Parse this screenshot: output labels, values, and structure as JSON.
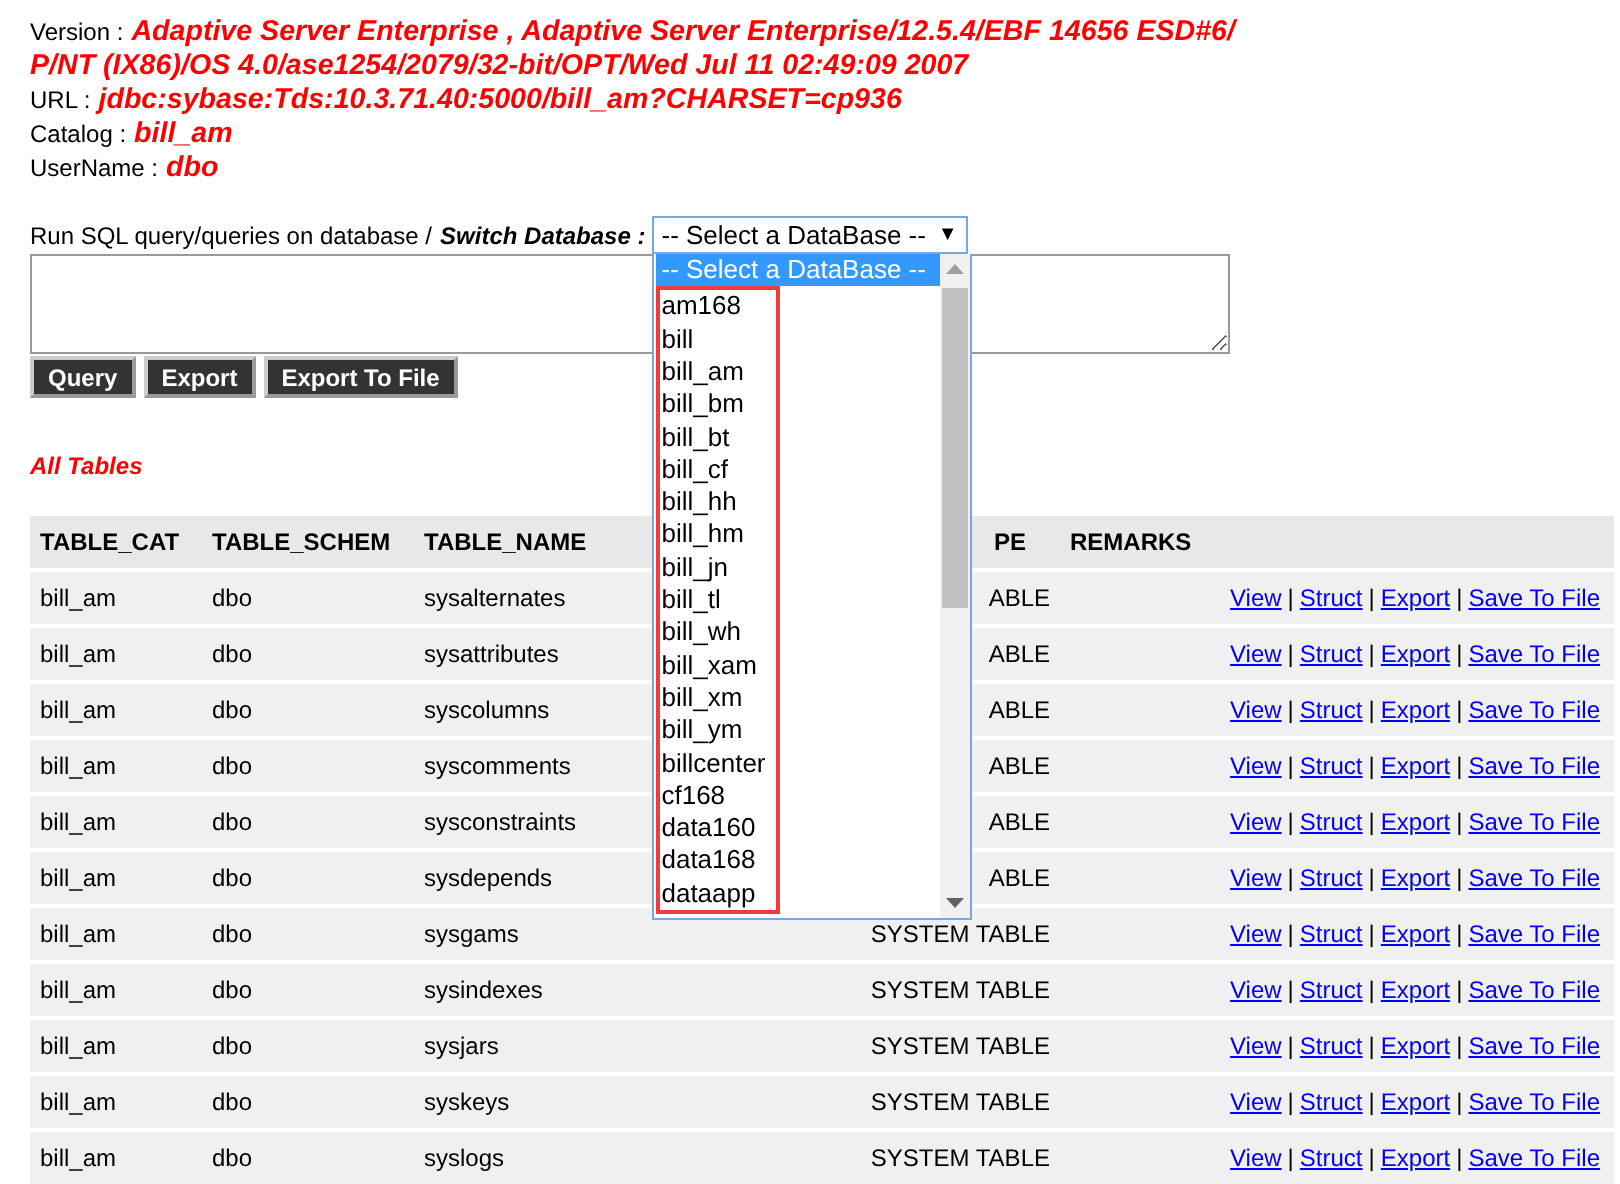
{
  "info": [
    {
      "label": "Version :",
      "value": "Adaptive Server Enterprise , Adaptive Server Enterprise/12.5.4/EBF 14656 ESD#6/",
      "value_line_2": "P/NT (IX86)/OS 4.0/ase1254/2079/32-bit/OPT/Wed Jul 11 02:49:09 2007"
    },
    {
      "label": "URL :",
      "value": "jdbc:sybase:Tds:10.3.71.40:5000/bill_am?CHARSET=cp936"
    },
    {
      "label": "Catalog :",
      "value": "bill_am"
    },
    {
      "label": "UserName :",
      "value": "dbo"
    }
  ],
  "query": {
    "label": "Run SQL query/queries on database /",
    "switch_label": "Switch Database :",
    "select_value": "-- Select a DataBase --",
    "caret": "▼",
    "options": [
      {
        "label": "-- Select a DataBase --",
        "selected": true
      },
      {
        "label": "am168",
        "selected": false
      },
      {
        "label": "bill",
        "selected": false
      },
      {
        "label": "bill_am",
        "selected": false
      },
      {
        "label": "bill_bm",
        "selected": false
      },
      {
        "label": "bill_bt",
        "selected": false
      },
      {
        "label": "bill_cf",
        "selected": false
      },
      {
        "label": "bill_hh",
        "selected": false
      },
      {
        "label": "bill_hm",
        "selected": false
      },
      {
        "label": "bill_jn",
        "selected": false
      },
      {
        "label": "bill_tl",
        "selected": false
      },
      {
        "label": "bill_wh",
        "selected": false
      },
      {
        "label": "bill_xam",
        "selected": false
      },
      {
        "label": "bill_xm",
        "selected": false
      },
      {
        "label": "bill_ym",
        "selected": false
      },
      {
        "label": "billcenter",
        "selected": false
      },
      {
        "label": "cf168",
        "selected": false
      },
      {
        "label": "data160",
        "selected": false
      },
      {
        "label": "data168",
        "selected": false
      },
      {
        "label": "dataapp",
        "selected": false
      }
    ],
    "buttons": [
      "Query",
      "Export",
      "Export To File"
    ]
  },
  "section_title": "All Tables",
  "table": {
    "columns": [
      "TABLE_CAT",
      "TABLE_SCHEM",
      "TABLE_NAME",
      "PE",
      "REMARKS"
    ],
    "rows": [
      {
        "cat": "bill_am",
        "schem": "dbo",
        "name": "sysalternates",
        "type": "ABLE",
        "actions": [
          {
            "kind": "link",
            "text": "View"
          },
          {
            "kind": "sep",
            "text": "|"
          },
          {
            "kind": "link",
            "text": "Struct"
          },
          {
            "kind": "sep",
            "text": "|"
          },
          {
            "kind": "link",
            "text": "Export"
          },
          {
            "kind": "sep",
            "text": "|"
          },
          {
            "kind": "link",
            "text": "Save To File"
          }
        ]
      },
      {
        "cat": "bill_am",
        "schem": "dbo",
        "name": "sysattributes",
        "type": "ABLE",
        "actions": [
          {
            "kind": "link",
            "text": "View"
          },
          {
            "kind": "sep",
            "text": "|"
          },
          {
            "kind": "link",
            "text": "Struct"
          },
          {
            "kind": "sep",
            "text": "|"
          },
          {
            "kind": "link",
            "text": "Export"
          },
          {
            "kind": "sep",
            "text": "|"
          },
          {
            "kind": "link",
            "text": "Save To File"
          }
        ]
      },
      {
        "cat": "bill_am",
        "schem": "dbo",
        "name": "syscolumns",
        "type": "ABLE",
        "actions": [
          {
            "kind": "link",
            "text": "View"
          },
          {
            "kind": "sep",
            "text": "|"
          },
          {
            "kind": "link",
            "text": "Struct"
          },
          {
            "kind": "sep",
            "text": "|"
          },
          {
            "kind": "link",
            "text": "Export"
          },
          {
            "kind": "sep",
            "text": "|"
          },
          {
            "kind": "link",
            "text": "Save To File"
          }
        ]
      },
      {
        "cat": "bill_am",
        "schem": "dbo",
        "name": "syscomments",
        "type": "ABLE",
        "actions": [
          {
            "kind": "link",
            "text": "View"
          },
          {
            "kind": "sep",
            "text": "|"
          },
          {
            "kind": "link",
            "text": "Struct"
          },
          {
            "kind": "sep",
            "text": "|"
          },
          {
            "kind": "link",
            "text": "Export"
          },
          {
            "kind": "sep",
            "text": "|"
          },
          {
            "kind": "link",
            "text": "Save To File"
          }
        ]
      },
      {
        "cat": "bill_am",
        "schem": "dbo",
        "name": "sysconstraints",
        "type": "ABLE",
        "actions": [
          {
            "kind": "link",
            "text": "View"
          },
          {
            "kind": "sep",
            "text": "|"
          },
          {
            "kind": "link",
            "text": "Struct"
          },
          {
            "kind": "sep",
            "text": "|"
          },
          {
            "kind": "link",
            "text": "Export"
          },
          {
            "kind": "sep",
            "text": "|"
          },
          {
            "kind": "link",
            "text": "Save To File"
          }
        ]
      },
      {
        "cat": "bill_am",
        "schem": "dbo",
        "name": "sysdepends",
        "type": "ABLE",
        "actions": [
          {
            "kind": "link",
            "text": "View"
          },
          {
            "kind": "sep",
            "text": "|"
          },
          {
            "kind": "link",
            "text": "Struct"
          },
          {
            "kind": "sep",
            "text": "|"
          },
          {
            "kind": "link",
            "text": "Export"
          },
          {
            "kind": "sep",
            "text": "|"
          },
          {
            "kind": "link",
            "text": "Save To File"
          }
        ]
      },
      {
        "cat": "bill_am",
        "schem": "dbo",
        "name": "sysgams",
        "type": "SYSTEM TABLE",
        "actions": [
          {
            "kind": "link",
            "text": "View"
          },
          {
            "kind": "sep",
            "text": "|"
          },
          {
            "kind": "link",
            "text": "Struct"
          },
          {
            "kind": "sep",
            "text": "|"
          },
          {
            "kind": "link",
            "text": "Export"
          },
          {
            "kind": "sep",
            "text": "|"
          },
          {
            "kind": "link",
            "text": "Save To File"
          }
        ]
      },
      {
        "cat": "bill_am",
        "schem": "dbo",
        "name": "sysindexes",
        "type": "SYSTEM TABLE",
        "actions": [
          {
            "kind": "link",
            "text": "View"
          },
          {
            "kind": "sep",
            "text": "|"
          },
          {
            "kind": "link",
            "text": "Struct"
          },
          {
            "kind": "sep",
            "text": "|"
          },
          {
            "kind": "link",
            "text": "Export"
          },
          {
            "kind": "sep",
            "text": "|"
          },
          {
            "kind": "link",
            "text": "Save To File"
          }
        ]
      },
      {
        "cat": "bill_am",
        "schem": "dbo",
        "name": "sysjars",
        "type": "SYSTEM TABLE",
        "actions": [
          {
            "kind": "link",
            "text": "View"
          },
          {
            "kind": "sep",
            "text": "|"
          },
          {
            "kind": "link",
            "text": "Struct"
          },
          {
            "kind": "sep",
            "text": "|"
          },
          {
            "kind": "link",
            "text": "Export"
          },
          {
            "kind": "sep",
            "text": "|"
          },
          {
            "kind": "link",
            "text": "Save To File"
          }
        ]
      },
      {
        "cat": "bill_am",
        "schem": "dbo",
        "name": "syskeys",
        "type": "SYSTEM TABLE",
        "actions": [
          {
            "kind": "link",
            "text": "View"
          },
          {
            "kind": "sep",
            "text": "|"
          },
          {
            "kind": "link",
            "text": "Struct"
          },
          {
            "kind": "sep",
            "text": "|"
          },
          {
            "kind": "link",
            "text": "Export"
          },
          {
            "kind": "sep",
            "text": "|"
          },
          {
            "kind": "link",
            "text": "Save To File"
          }
        ]
      },
      {
        "cat": "bill_am",
        "schem": "dbo",
        "name": "syslogs",
        "type": "SYSTEM TABLE",
        "actions": [
          {
            "kind": "link",
            "text": "View"
          },
          {
            "kind": "sep",
            "text": "|"
          },
          {
            "kind": "link",
            "text": "Struct"
          },
          {
            "kind": "sep",
            "text": "|"
          },
          {
            "kind": "link",
            "text": "Export"
          },
          {
            "kind": "sep",
            "text": "|"
          },
          {
            "kind": "link",
            "text": "Save To File"
          }
        ]
      }
    ]
  }
}
